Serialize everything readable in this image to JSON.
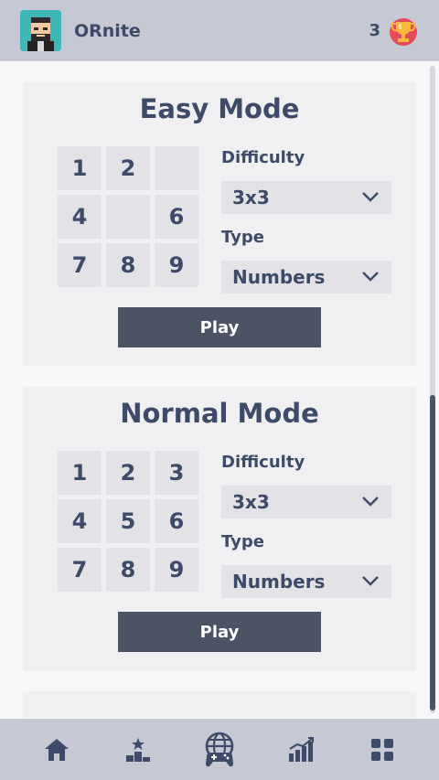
{
  "header": {
    "username": "ORnite",
    "score": "3",
    "avatar_icon": "avatar-icon",
    "trophy_icon": "trophy-icon"
  },
  "cards": [
    {
      "title": "Easy Mode",
      "tiles": [
        "1",
        "2",
        "",
        "4",
        "",
        "6",
        "7",
        "8",
        "9"
      ],
      "difficulty_label": "Difficulty",
      "difficulty_value": "3x3",
      "type_label": "Type",
      "type_value": "Numbers",
      "play_label": "Play"
    },
    {
      "title": "Normal Mode",
      "tiles": [
        "1",
        "2",
        "3",
        "4",
        "5",
        "6",
        "7",
        "8",
        "9"
      ],
      "difficulty_label": "Difficulty",
      "difficulty_value": "3x3",
      "type_label": "Type",
      "type_value": "Numbers",
      "play_label": "Play"
    }
  ],
  "nav": [
    {
      "icon": "home-icon"
    },
    {
      "icon": "leaderboard-icon"
    },
    {
      "icon": "online-game-icon"
    },
    {
      "icon": "stats-icon"
    },
    {
      "icon": "menu-grid-icon"
    }
  ],
  "colors": {
    "accent": "#3d4a68",
    "button": "#4b5364",
    "bar_bg": "#c6c8d3",
    "card_bg": "#f0f0f3",
    "tile_bg": "#e3e3e7"
  }
}
